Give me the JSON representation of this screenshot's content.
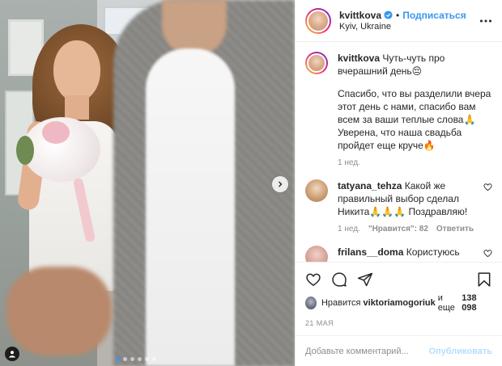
{
  "header": {
    "username": "kvittkova",
    "separator": "•",
    "follow_label": "Подписаться",
    "location": "Kyiv, Ukraine"
  },
  "caption": {
    "username": "kvittkova",
    "text_1": "Чуть-чуть про вчерашний день😔",
    "text_2": "Спасибо, что вы разделили вчера этот день с нами, спасибо вам всем за ваши теплые слова🙏 Уверена, что наша свадьба пройдет еще круче🔥",
    "time": "1 нед."
  },
  "comments": [
    {
      "username": "tatyana_tehza",
      "text": "Какой же правильный выбор сделал Никита🙏🙏🙏 Поздравляю!",
      "time": "1 нед.",
      "likes": "\"Нравится\": 82",
      "reply": "Ответить"
    },
    {
      "username": "frilans__doma",
      "text": "Користуюсь нагодою, хочу запропонувати"
    }
  ],
  "likes": {
    "prefix": "Нравится",
    "user": "viktoriamogoriuk",
    "middle": "и еще",
    "count": "138 098"
  },
  "date": "21 МАЯ",
  "comment_box": {
    "placeholder": "Добавьте комментарий...",
    "publish_label": "Опубликовать"
  },
  "carousel": {
    "count": 6,
    "active_index": 0
  },
  "colors": {
    "accent": "#3897f0",
    "muted": "#8e8e8e",
    "publish_disabled": "#b2dffc"
  },
  "icons": [
    "verified-icon",
    "more-icon",
    "heart-icon",
    "comment-icon",
    "share-icon",
    "bookmark-icon",
    "chevron-right-icon",
    "person-tag-icon"
  ]
}
